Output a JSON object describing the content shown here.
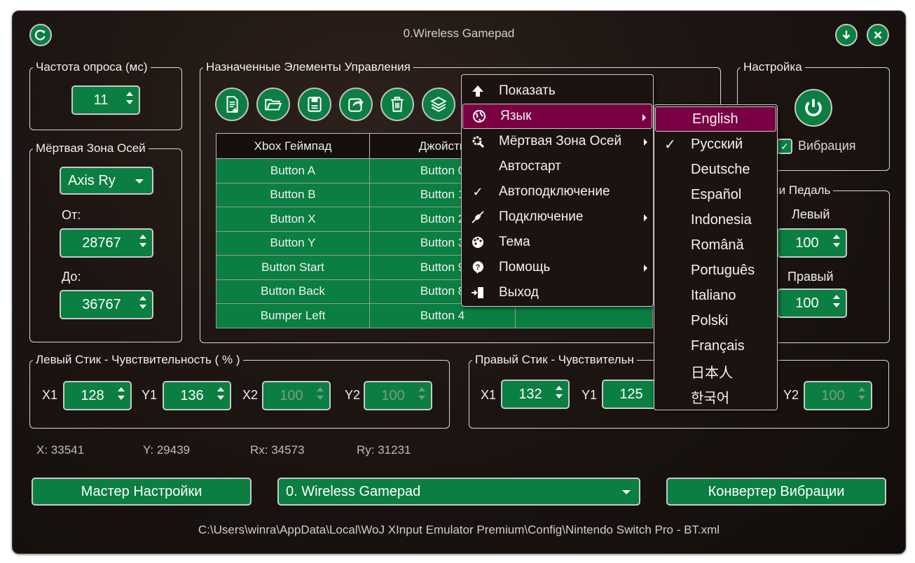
{
  "window": {
    "title": "0.Wireless Gamepad"
  },
  "header_buttons": {
    "refresh": "refresh-icon",
    "minimize": "arrow-down-icon",
    "close": "close-icon"
  },
  "poll_rate": {
    "legend": "Частота опроса (мс)",
    "value": "11"
  },
  "deadzone": {
    "legend": "Мёртвая Зона Осей",
    "axis_selected": "Axis Ry",
    "from_label": "От:",
    "from_value": "28767",
    "to_label": "До:",
    "to_value": "36767"
  },
  "mapping": {
    "legend": "Назначенные Элементы Управления",
    "toolbar": [
      "new-file-icon",
      "open-folder-icon",
      "save-icon",
      "export-icon",
      "delete-icon",
      "layers-icon"
    ],
    "columns": [
      "Xbox Геймпад",
      "Джойсти"
    ],
    "rows": [
      [
        "Button A",
        "Button 0"
      ],
      [
        "Button B",
        "Button 1"
      ],
      [
        "Button X",
        "Button 2"
      ],
      [
        "Button Y",
        "Button 3"
      ],
      [
        "Button Start",
        "Button 9"
      ],
      [
        "Button Back",
        "Button 8"
      ],
      [
        "Bumper Left",
        "Button 4"
      ]
    ]
  },
  "settings": {
    "legend": "Настройка",
    "vibration_label": "Вибрация",
    "vibration_checked": true
  },
  "trigger": {
    "legend": "Триггер или Педаль",
    "legend_visible": "тер или Педаль",
    "left_label": "Левый",
    "left_value": "100",
    "right_label": "Правый",
    "right_value": "100"
  },
  "left_stick": {
    "legend": "Левый Стик - Чувствительность ( % )",
    "x1_label": "X1",
    "x1": "128",
    "y1_label": "Y1",
    "y1": "136",
    "x2_label": "X2",
    "x2": "100",
    "y2_label": "Y2",
    "y2": "100"
  },
  "right_stick": {
    "legend": "Правый Стик - Чувствительн",
    "x1_label": "X1",
    "x1": "132",
    "y1_label": "Y1",
    "y1": "125",
    "y2_label": "Y2",
    "y2": "100"
  },
  "axes_status": {
    "x": "X: 33541",
    "y": "Y: 29439",
    "rx": "Rx: 34573",
    "ry": "Ry: 31231"
  },
  "bottom": {
    "wizard_button": "Мастер Настройки",
    "device_selected": "0. Wireless Gamepad",
    "vibration_converter_button": "Конвертер Вибрации",
    "config_path": "C:\\Users\\winra\\AppData\\Local\\WoJ XInput Emulator Premium\\Config\\Nintendo Switch Pro - BT.xml"
  },
  "context_menu": {
    "items": [
      {
        "label": "Показать",
        "icon": "arrow-up-icon",
        "submenu": false
      },
      {
        "label": "Язык",
        "icon": "globe-icon",
        "submenu": true,
        "highlighted": true
      },
      {
        "label": "Мёртвая Зона Осей",
        "icon": "gear-search-icon",
        "submenu": true
      },
      {
        "label": "Автостарт",
        "icon": "",
        "submenu": false
      },
      {
        "label": "Автоподключение",
        "icon": "check-icon",
        "submenu": false,
        "checked": true
      },
      {
        "label": "Подключение",
        "icon": "plug-icon",
        "submenu": true
      },
      {
        "label": "Тема",
        "icon": "palette-icon",
        "submenu": false
      },
      {
        "label": "Помощь",
        "icon": "help-icon",
        "submenu": true
      },
      {
        "label": "Выход",
        "icon": "exit-door-icon",
        "submenu": false
      }
    ]
  },
  "language_menu": {
    "items": [
      {
        "label": "English",
        "highlighted": true
      },
      {
        "label": "Русский",
        "checked": true
      },
      {
        "label": "Deutsche"
      },
      {
        "label": "Español"
      },
      {
        "label": "Indonesia"
      },
      {
        "label": "Română"
      },
      {
        "label": "Português"
      },
      {
        "label": "Italiano"
      },
      {
        "label": "Polski"
      },
      {
        "label": "Français"
      },
      {
        "label": "日本人"
      },
      {
        "label": "한국어"
      }
    ],
    "check_glyph": "✓"
  },
  "colors": {
    "accent_green": "#0a7f41",
    "highlight_magenta": "#7b0043",
    "background": "#1d1512"
  }
}
